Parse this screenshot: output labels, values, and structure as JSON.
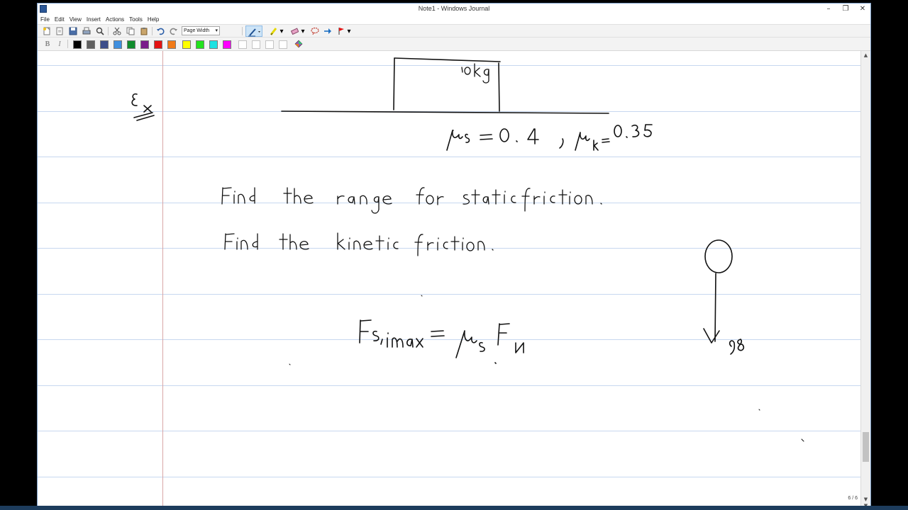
{
  "window": {
    "title": "Note1 - Windows Journal",
    "controls": {
      "minimize": "–",
      "maximize": "❐",
      "close": "✕"
    }
  },
  "menu": [
    "File",
    "Edit",
    "View",
    "Insert",
    "Actions",
    "Tools",
    "Help"
  ],
  "toolbar": {
    "zoom_select": "Page Width",
    "bold": "B",
    "italic": "I",
    "palette": [
      "#000000",
      "#606060",
      "#3d4e8a",
      "#3f8fdf",
      "#108c2c",
      "#7a1e8a",
      "#e41313",
      "#f17a17",
      "#ffff00",
      "#22e21c",
      "#1ce2e2",
      "#ff00ff",
      "#ffffff",
      "#ffffff",
      "#ffffff",
      "#ffffff"
    ]
  },
  "status": {
    "page_indicator": "6 / 6"
  },
  "colors": {
    "ink": "#111111",
    "rule": "#c7d7ef",
    "margin": "#d9a6a6"
  }
}
